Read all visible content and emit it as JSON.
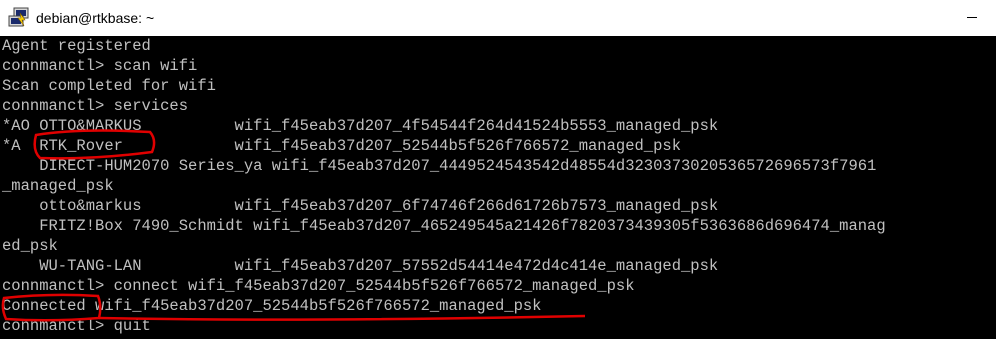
{
  "window": {
    "title": "debian@rtkbase: ~",
    "icon": "putty-icon"
  },
  "terminal": {
    "lines": [
      "Agent registered",
      "connmanctl> scan wifi",
      "Scan completed for wifi",
      "connmanctl> services",
      "*AO OTTO&MARKUS          wifi_f45eab37d207_4f54544f264d41524b5553_managed_psk",
      "*A  RTK_Rover            wifi_f45eab37d207_52544b5f526f766572_managed_psk",
      "    DIRECT-HUM2070 Series_ya wifi_f45eab37d207_4449524543542d48554d3230373020536572696573f7961",
      "_managed_psk",
      "    otto&markus          wifi_f45eab37d207_6f74746f266d61726b7573_managed_psk",
      "    FRITZ!Box 7490_Schmidt wifi_f45eab37d207_465249545a21426f7820373439305f5363686d696474_manag",
      "ed_psk",
      "    WU-TANG-LAN          wifi_f45eab37d207_57552d54414e472d4c414e_managed_psk",
      "connmanctl> connect wifi_f45eab37d207_52544b5f526f766572_managed_psk",
      "Connected wifi_f45eab37d207_52544b5f526f766572_managed_psk",
      "connmanctl> quit"
    ]
  },
  "colors": {
    "terminal_bg": "#000000",
    "terminal_fg": "#c0c0c0",
    "annotation": "#e00000",
    "titlebar_bg": "#ffffff"
  }
}
